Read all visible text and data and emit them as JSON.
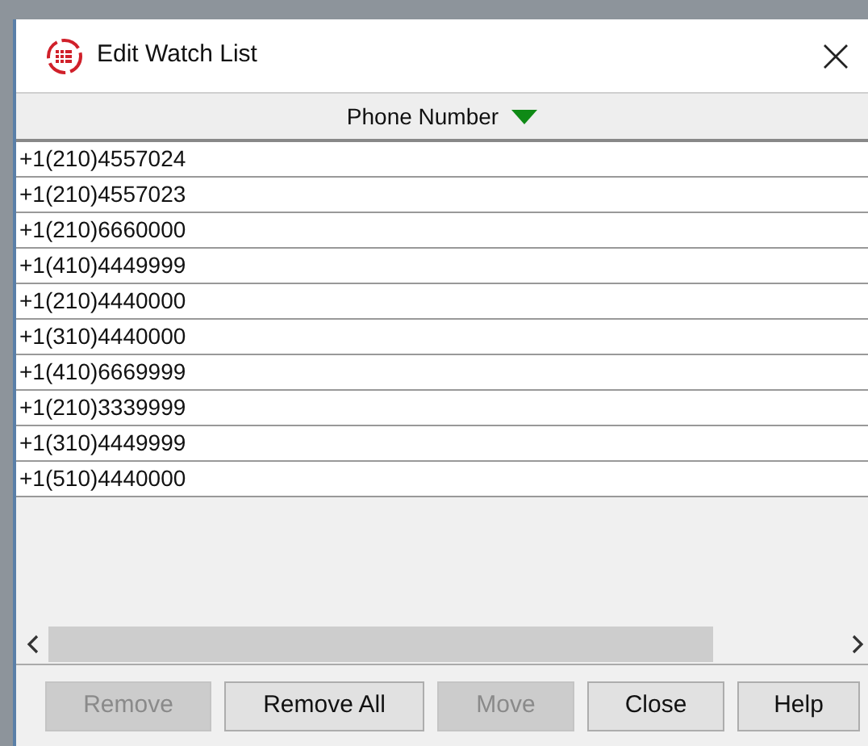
{
  "window": {
    "title": "Edit Watch List"
  },
  "table": {
    "columns": [
      {
        "label": "Phone Number",
        "sorted_descending": true
      }
    ],
    "rows": [
      "+1(210)4557024",
      "+1(210)4557023",
      "+1(210)6660000",
      "+1(410)4449999",
      "+1(210)4440000",
      "+1(310)4440000",
      "+1(410)6669999",
      "+1(210)3339999",
      "+1(310)4449999",
      "+1(510)4440000"
    ]
  },
  "buttons": [
    {
      "label": "Remove",
      "disabled": true
    },
    {
      "label": "Remove All",
      "disabled": false
    },
    {
      "label": "Move",
      "disabled": true
    },
    {
      "label": "Close",
      "disabled": false
    },
    {
      "label": "Help",
      "disabled": false
    }
  ]
}
